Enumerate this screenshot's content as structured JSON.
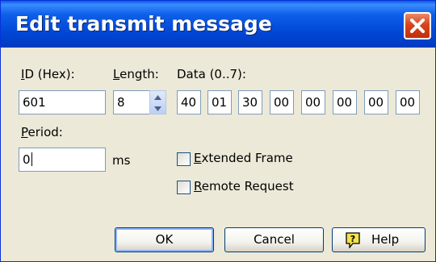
{
  "window": {
    "title": "Edit transmit message"
  },
  "fields": {
    "id_label": {
      "hot": "I",
      "rest": "D (Hex):"
    },
    "id_value": "601",
    "length_label": {
      "hot": "L",
      "rest": "ength:"
    },
    "length_value": "8",
    "data_label": "Data (0..7):",
    "data_bytes": [
      "40",
      "01",
      "30",
      "00",
      "00",
      "00",
      "00",
      "00"
    ],
    "period_label": {
      "hot": "P",
      "rest": "eriod:"
    },
    "period_value": "0",
    "period_unit": "ms"
  },
  "options": {
    "extended": {
      "hot": "E",
      "rest": "xtended Frame",
      "checked": false
    },
    "remote": {
      "hot": "R",
      "rest": "emote Request",
      "checked": false
    }
  },
  "buttons": {
    "ok": "OK",
    "cancel": "Cancel",
    "help": {
      "hot": "H",
      "rest": "elp"
    }
  },
  "icons": {
    "close": "close-icon",
    "spin_up": "arrow-up-icon",
    "spin_down": "arrow-down-icon",
    "help": "help-icon"
  },
  "colors": {
    "titlebar": "#0046d5",
    "close": "#d8441c",
    "dialog": "#ece9d8"
  }
}
